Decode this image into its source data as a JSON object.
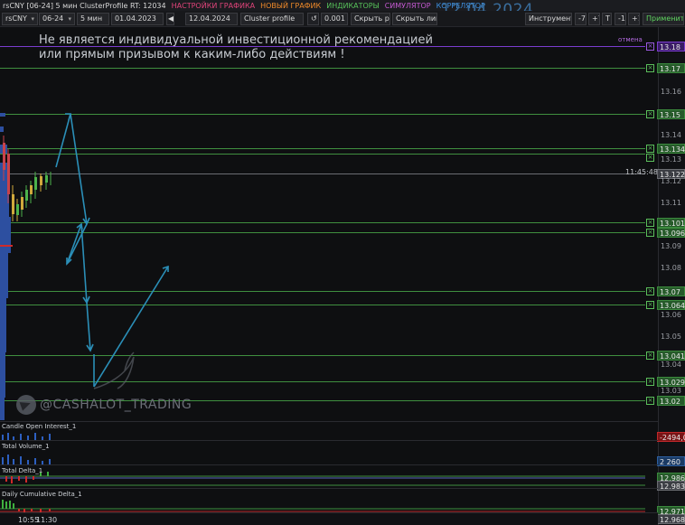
{
  "titlebar": {
    "instrument_title": "rsCNY [06-24] 5 мин ClusterProfile RT: 12034",
    "menu": [
      "НАСТРОЙКИ ГРАФИКА",
      "НОВЫЙ ГРАФИК",
      "ИНДИКАТОРЫ",
      "СИМУЛЯТОР",
      "КОРРЕЛЯТОР"
    ],
    "big_date": "12.04.2024"
  },
  "toolbar": {
    "symbol": "rsCNY",
    "contract": "06-24",
    "timeframe": "5 мин",
    "date_from": "01.04.2023",
    "date_to": "12.04.2024",
    "profile_type": "Cluster profile",
    "step_value": "0.001",
    "hide_drawings": "Скрыть рис.",
    "hide_lines": "Скрыть линии",
    "instruments": "Инструменты",
    "btn_m7": "-7",
    "btn_p7": "+7",
    "btn_t": "T",
    "btn_m1": "-1",
    "btn_p1": "+1",
    "apply": "Применить",
    "colors": {
      "apply": "#5fd35f"
    }
  },
  "chart": {
    "disclaimer_line1": "Не является индивидуальной инвестиционной рекомендацией",
    "disclaimer_line2": "или прямым призывом к каким-либо действиям !",
    "cancel_label": "отмена",
    "current_time": "11:45:48",
    "watermark": "@CASHALOT_TRADING",
    "level_labels": {
      "l1318": "13.18",
      "l1317": "13.17",
      "l1315": "13.15",
      "l13134": "13.134",
      "l13122": "13.122",
      "l13101": "13.101",
      "l13096": "13.096",
      "l1307": "13.07",
      "l13064": "13.064",
      "l13041": "13.041",
      "l13029": "13.029",
      "l1302": "13.02"
    },
    "ticks": {
      "t1316": "13.16",
      "t1314": "13.14",
      "t1313": "13.13",
      "t1312": "13.12",
      "t1311": "13.11",
      "t131": "13.1",
      "t1309": "13.09",
      "t1308": "13.08",
      "t1306": "13.06",
      "t1305": "13.05",
      "t1304": "13.04",
      "t1303": "13.03"
    }
  },
  "indicators": {
    "oi_label": "Candle Open Interest_1",
    "oi_value": "-2494,00",
    "vol_label": "Total Volume_1",
    "vol_value": "2 260",
    "delta_label": "Total Delta_1",
    "delta_v1": "12.986",
    "delta_v2": "12.983",
    "cumdelta_label": "Daily Cumulative Delta_1",
    "cum_v1": "12.971",
    "cum_v2": "12.968"
  },
  "timeaxis": {
    "t1": "10:55",
    "t2": "11:30"
  }
}
